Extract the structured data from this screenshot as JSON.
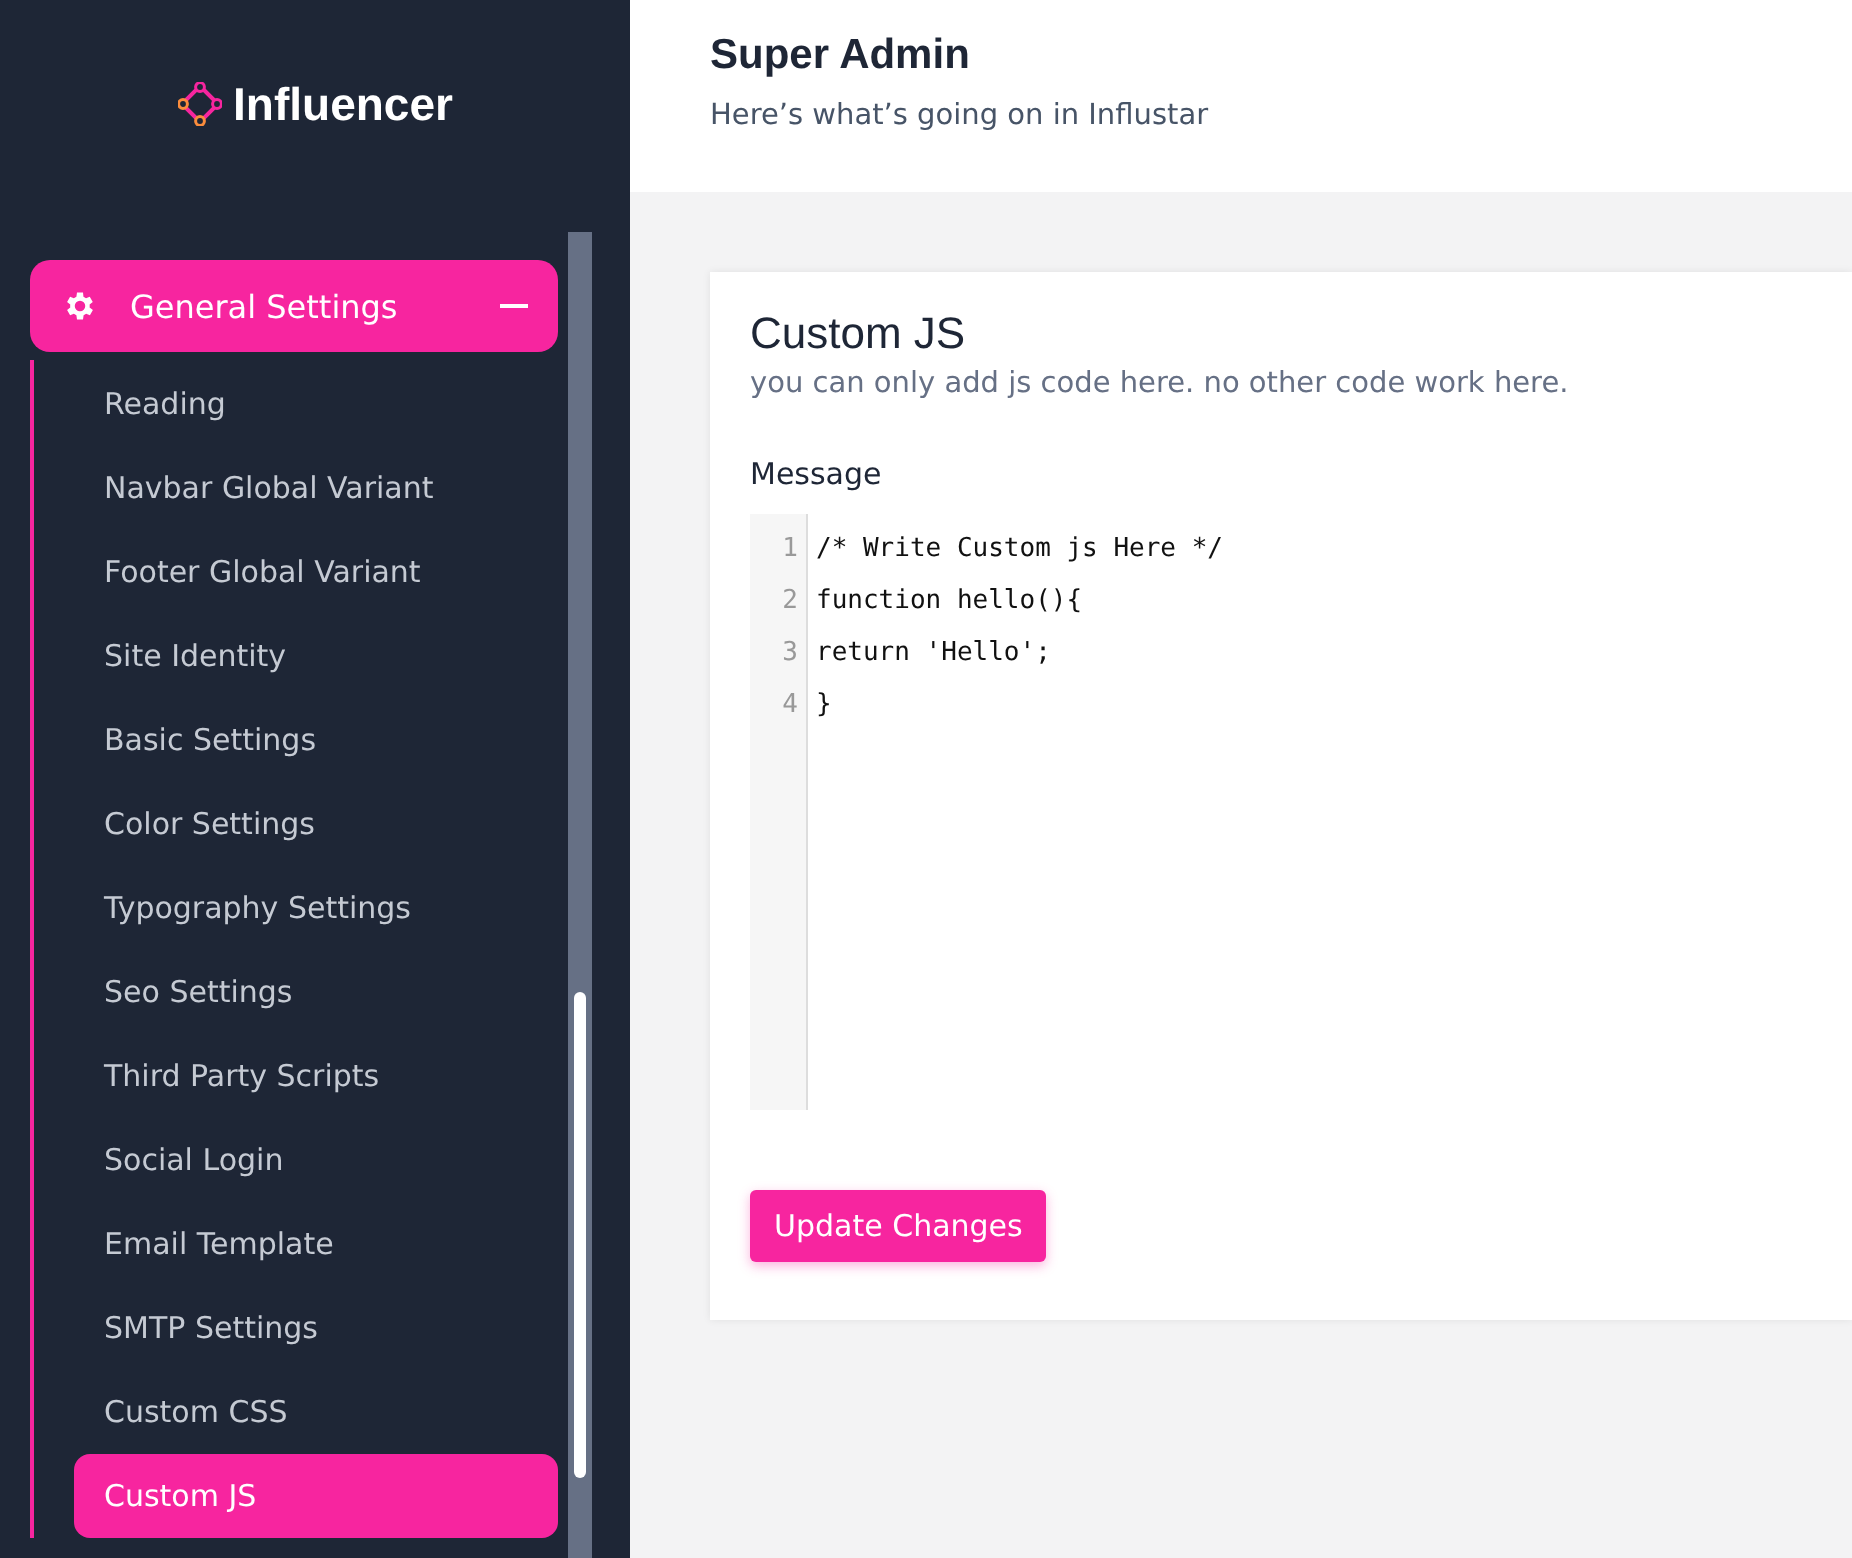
{
  "sidebar": {
    "logo": "Influencer",
    "group": {
      "label": "General Settings",
      "expanded": true,
      "items": [
        {
          "label": "Reading",
          "selected": false
        },
        {
          "label": "Navbar Global Variant",
          "selected": false
        },
        {
          "label": "Footer Global Variant",
          "selected": false
        },
        {
          "label": "Site Identity",
          "selected": false
        },
        {
          "label": "Basic Settings",
          "selected": false
        },
        {
          "label": "Color Settings",
          "selected": false
        },
        {
          "label": "Typography Settings",
          "selected": false
        },
        {
          "label": "Seo Settings",
          "selected": false
        },
        {
          "label": "Third Party Scripts",
          "selected": false
        },
        {
          "label": "Social Login",
          "selected": false
        },
        {
          "label": "Email Template",
          "selected": false
        },
        {
          "label": "SMTP Settings",
          "selected": false
        },
        {
          "label": "Custom CSS",
          "selected": false
        },
        {
          "label": "Custom JS",
          "selected": true
        }
      ]
    }
  },
  "header": {
    "title": "Super Admin",
    "subtitle": "Here’s what’s going on in Influstar"
  },
  "card": {
    "title": "Custom JS",
    "description": "you can only add js code here. no other code work here.",
    "field_label": "Message",
    "editor": {
      "lines": [
        {
          "number": "1",
          "code": "/* Write Custom js Here */"
        },
        {
          "number": "2",
          "code": "function hello(){"
        },
        {
          "number": "3",
          "code": "return 'Hello';"
        },
        {
          "number": "4",
          "code": "}"
        }
      ]
    },
    "button": "Update Changes"
  }
}
